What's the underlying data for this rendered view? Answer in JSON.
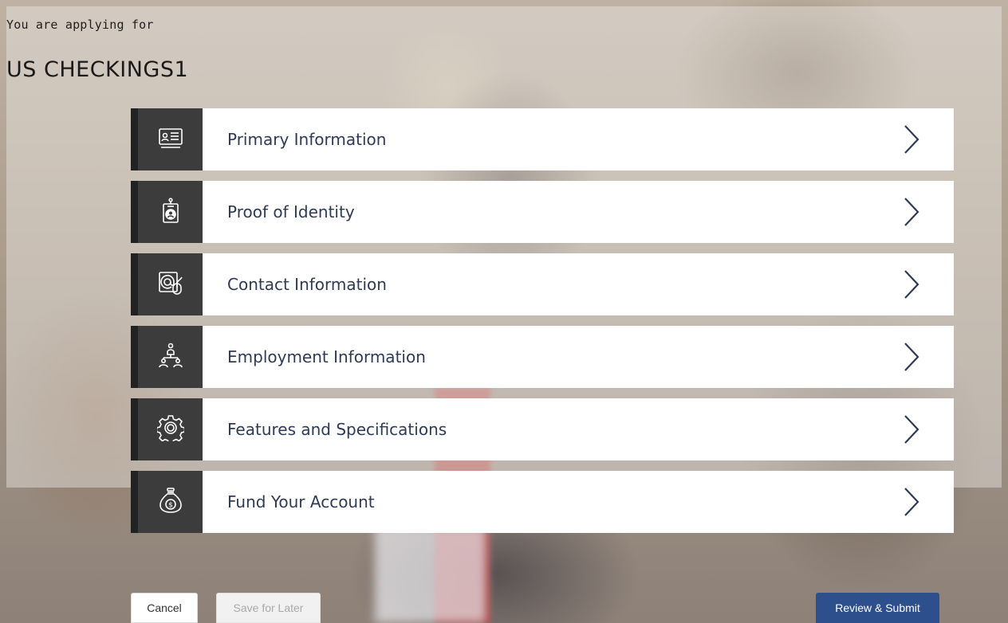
{
  "header": {
    "subtitle": "You are applying for",
    "product_name": "US CHECKINGS1"
  },
  "sections": [
    {
      "label": "Primary Information",
      "icon": "id-card-icon"
    },
    {
      "label": "Proof of Identity",
      "icon": "id-badge-icon"
    },
    {
      "label": "Contact Information",
      "icon": "email-contact-icon"
    },
    {
      "label": "Employment Information",
      "icon": "org-chart-icon"
    },
    {
      "label": "Features and Specifications",
      "icon": "gear-icon"
    },
    {
      "label": "Fund Your Account",
      "icon": "money-bag-icon"
    }
  ],
  "actions": {
    "cancel_label": "Cancel",
    "save_label": "Save for Later",
    "review_label": "Review & Submit"
  },
  "colors": {
    "icon_box": "#3c3c3c",
    "label_text": "#2e3b57",
    "primary_button": "#2d4f8c"
  }
}
